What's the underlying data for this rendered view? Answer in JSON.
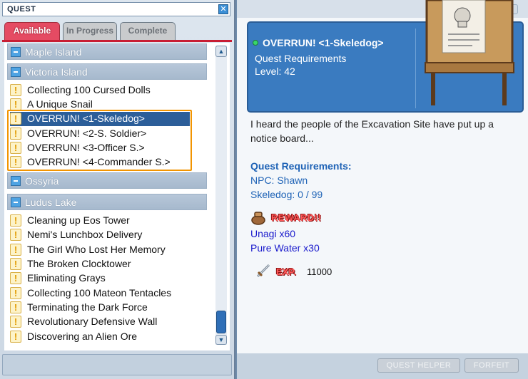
{
  "window": {
    "title": "QUEST",
    "close_glyph": "✕"
  },
  "tabs": [
    {
      "label": "Available",
      "active": true
    },
    {
      "label": "In Progress",
      "active": false
    },
    {
      "label": "Complete",
      "active": false
    }
  ],
  "categories": [
    {
      "label": "Maple Island",
      "expanded": true
    },
    {
      "label": "Victoria Island",
      "expanded": true
    },
    {
      "label": "Ossyria",
      "expanded": true
    },
    {
      "label": "Ludus Lake",
      "expanded": true
    }
  ],
  "victoria_quests": [
    "Collecting 100 Cursed Dolls",
    "A Unique Snail",
    "OVERRUN! <1-Skeledog>",
    "OVERRUN! <2-S. Soldier>",
    "OVERRUN! <3-Officer S.>",
    "OVERRUN! <4-Commander S.>"
  ],
  "ludus_quests": [
    "Cleaning up Eos Tower",
    "Nemi's Lunchbox Delivery",
    "The Girl Who Lost Her Memory",
    "The Broken Clocktower",
    "Eliminating Grays",
    "Collecting 100 Mateon Tentacles",
    "Terminating the Dark Force",
    "Revolutionary Defensive Wall",
    "Discovering an Alien Ore"
  ],
  "selected_quest": "OVERRUN! <1-Skeledog>",
  "detail": {
    "title": "OVERRUN! <1-Skeledog>",
    "req_label": "Quest Requirements",
    "level_label": "Level: 42",
    "description": "I heard the people of the Excavation Site have put up a notice board...",
    "req_heading": "Quest Requirements:",
    "npc": "NPC: Shawn",
    "kill": "Skeledog:  0 / 99",
    "reward_title": "REWARD!!",
    "rewards": [
      "Unagi x60",
      "Pure Water x30"
    ],
    "exp_label": "EXP.",
    "exp_value": "11000"
  },
  "buttons": {
    "helper": "QUEST HELPER",
    "forfeit": "FORFEIT"
  },
  "colors": {
    "accent_tab": "#e54b63",
    "selection": "#2c5e99",
    "highlight_box": "#f29400",
    "card_blue": "#3a7bc0",
    "link_blue": "#1f63b6"
  }
}
